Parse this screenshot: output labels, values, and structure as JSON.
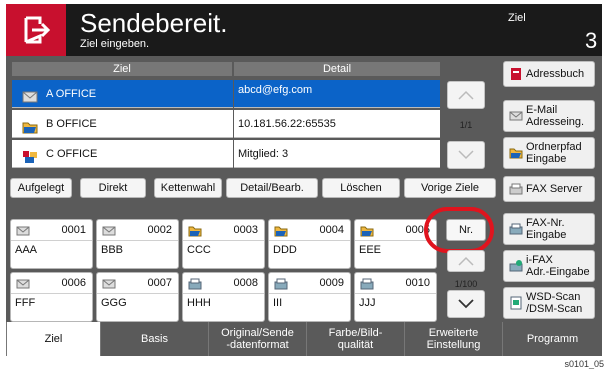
{
  "header": {
    "title": "Sendebereit.",
    "subtitle": "Ziel eingeben.",
    "ziel_label": "Ziel",
    "ziel_count": "3"
  },
  "table": {
    "col_ziel": "Ziel",
    "col_detail": "Detail",
    "rows": [
      {
        "name": "A OFFICE",
        "detail": "abcd@efg.com",
        "icon": "email-icon"
      },
      {
        "name": "B OFFICE",
        "detail": "10.181.56.22:65535",
        "icon": "folder-icon"
      },
      {
        "name": "C OFFICE",
        "detail": "Mitglied:   3",
        "icon": "group-icon"
      }
    ],
    "page_indicator": "1/1"
  },
  "side_buttons": [
    {
      "label": "Adressbuch",
      "icon": "address-book-icon"
    },
    {
      "label": "E-Mail\nAdresseing.",
      "icon": "email-icon"
    },
    {
      "label": "Ordnerpfad\nEingabe",
      "icon": "folder-icon"
    },
    {
      "label": "FAX Server",
      "icon": "fax-server-icon"
    },
    {
      "label": "FAX-Nr.\nEingabe",
      "icon": "fax-icon"
    },
    {
      "label": "i-FAX\nAdr.-Eingabe",
      "icon": "ifax-icon"
    },
    {
      "label": "WSD-Scan\n/DSM-Scan",
      "icon": "scan-icon"
    }
  ],
  "actions": [
    "Aufgelegt",
    "Direkt",
    "Kettenwahl",
    "Detail/Bearb.",
    "Löschen",
    "Vorige Ziele"
  ],
  "onetouch": [
    {
      "num": "0001",
      "name": "AAA",
      "icon": "email-icon"
    },
    {
      "num": "0002",
      "name": "BBB",
      "icon": "email-icon"
    },
    {
      "num": "0003",
      "name": "CCC",
      "icon": "folder-icon"
    },
    {
      "num": "0004",
      "name": "DDD",
      "icon": "folder-icon"
    },
    {
      "num": "0005",
      "name": "EEE",
      "icon": "folder-icon"
    },
    {
      "num": "0006",
      "name": "FFF",
      "icon": "email-icon"
    },
    {
      "num": "0007",
      "name": "GGG",
      "icon": "email-icon"
    },
    {
      "num": "0008",
      "name": "HHH",
      "icon": "fax-icon"
    },
    {
      "num": "0009",
      "name": "III",
      "icon": "fax-icon"
    },
    {
      "num": "0010",
      "name": "JJJ",
      "icon": "fax-icon"
    }
  ],
  "grid": {
    "nr_label": "Nr.",
    "page_indicator": "1/100"
  },
  "tabs": [
    {
      "label": "Ziel",
      "active": true
    },
    {
      "label": "Basis",
      "active": false
    },
    {
      "label": "Original/Sende\n-datenformat",
      "active": false
    },
    {
      "label": "Farbe/Bild-\nqualität",
      "active": false
    },
    {
      "label": "Erweiterte\nEinstellung",
      "active": false
    },
    {
      "label": "Programm",
      "active": false
    }
  ],
  "footer_code": "s0101_05",
  "colors": {
    "accent_red": "#c8102e",
    "selected_blue": "#0b63c8",
    "panel_gray": "#5a5a5a",
    "header_black": "#1a1a1a"
  }
}
